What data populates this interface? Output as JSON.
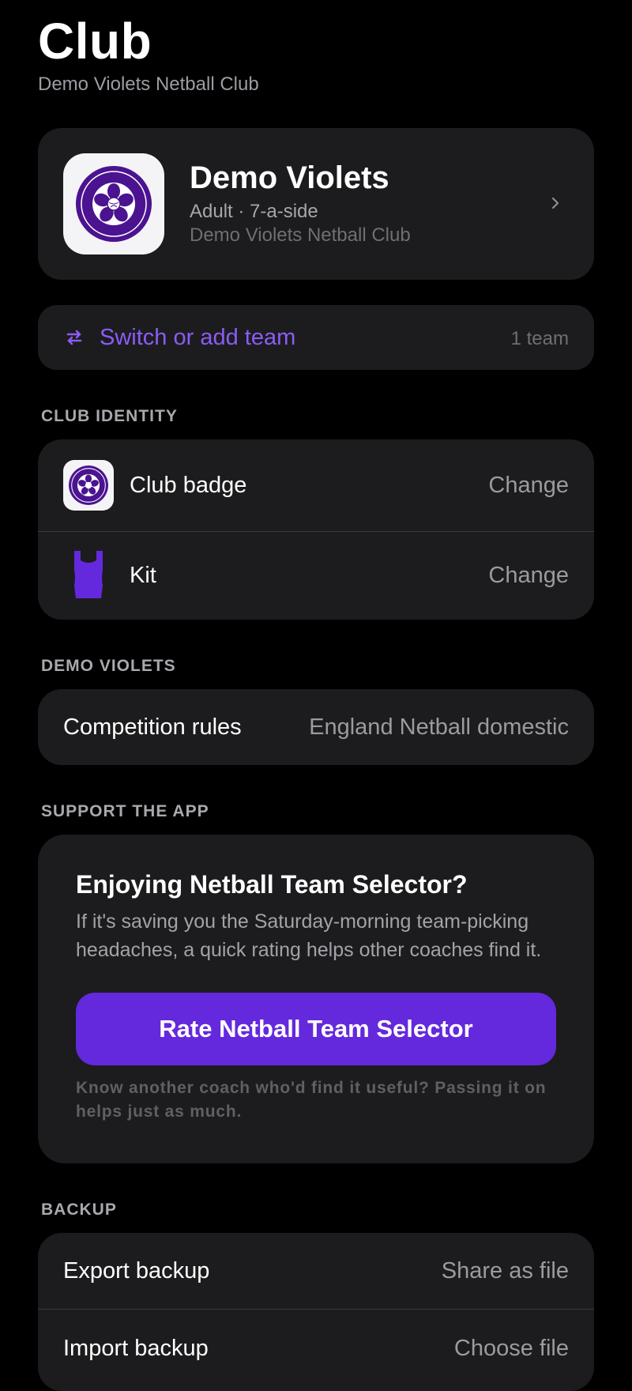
{
  "header": {
    "title": "Club",
    "subtitle": "Demo Violets Netball Club"
  },
  "team_card": {
    "badge_icon": "club-badge-icon",
    "name": "Demo Violets",
    "meta": "Adult · 7-a-side",
    "club": "Demo Violets Netball Club"
  },
  "switch_team": {
    "icon": "swap-arrows-icon",
    "label": "Switch or add team",
    "count": "1 team"
  },
  "club_identity": {
    "section_label": "CLUB IDENTITY",
    "badge_label": "Club badge",
    "badge_action": "Change",
    "kit_label": "Kit",
    "kit_action": "Change"
  },
  "team_section": {
    "section_label": "DEMO VIOLETS",
    "rules_label": "Competition rules",
    "rules_value": "England Netball domestic"
  },
  "support": {
    "section_label": "SUPPORT THE APP",
    "heading": "Enjoying Netball Team Selector?",
    "body": "If it's saving you the Saturday-morning team-picking headaches, a quick rating helps other coaches find it.",
    "button_label": "Rate Netball Team Selector",
    "footnote": "Know another coach who'd find it useful? Passing it on helps just as much."
  },
  "backup": {
    "section_label": "BACKUP",
    "export_label": "Export backup",
    "export_value": "Share as file",
    "import_label": "Import backup",
    "import_value": "Choose file"
  },
  "colors": {
    "accent": "#6429dc",
    "accent_text": "#8b5cf6",
    "badge_purple": "#4b1390"
  }
}
